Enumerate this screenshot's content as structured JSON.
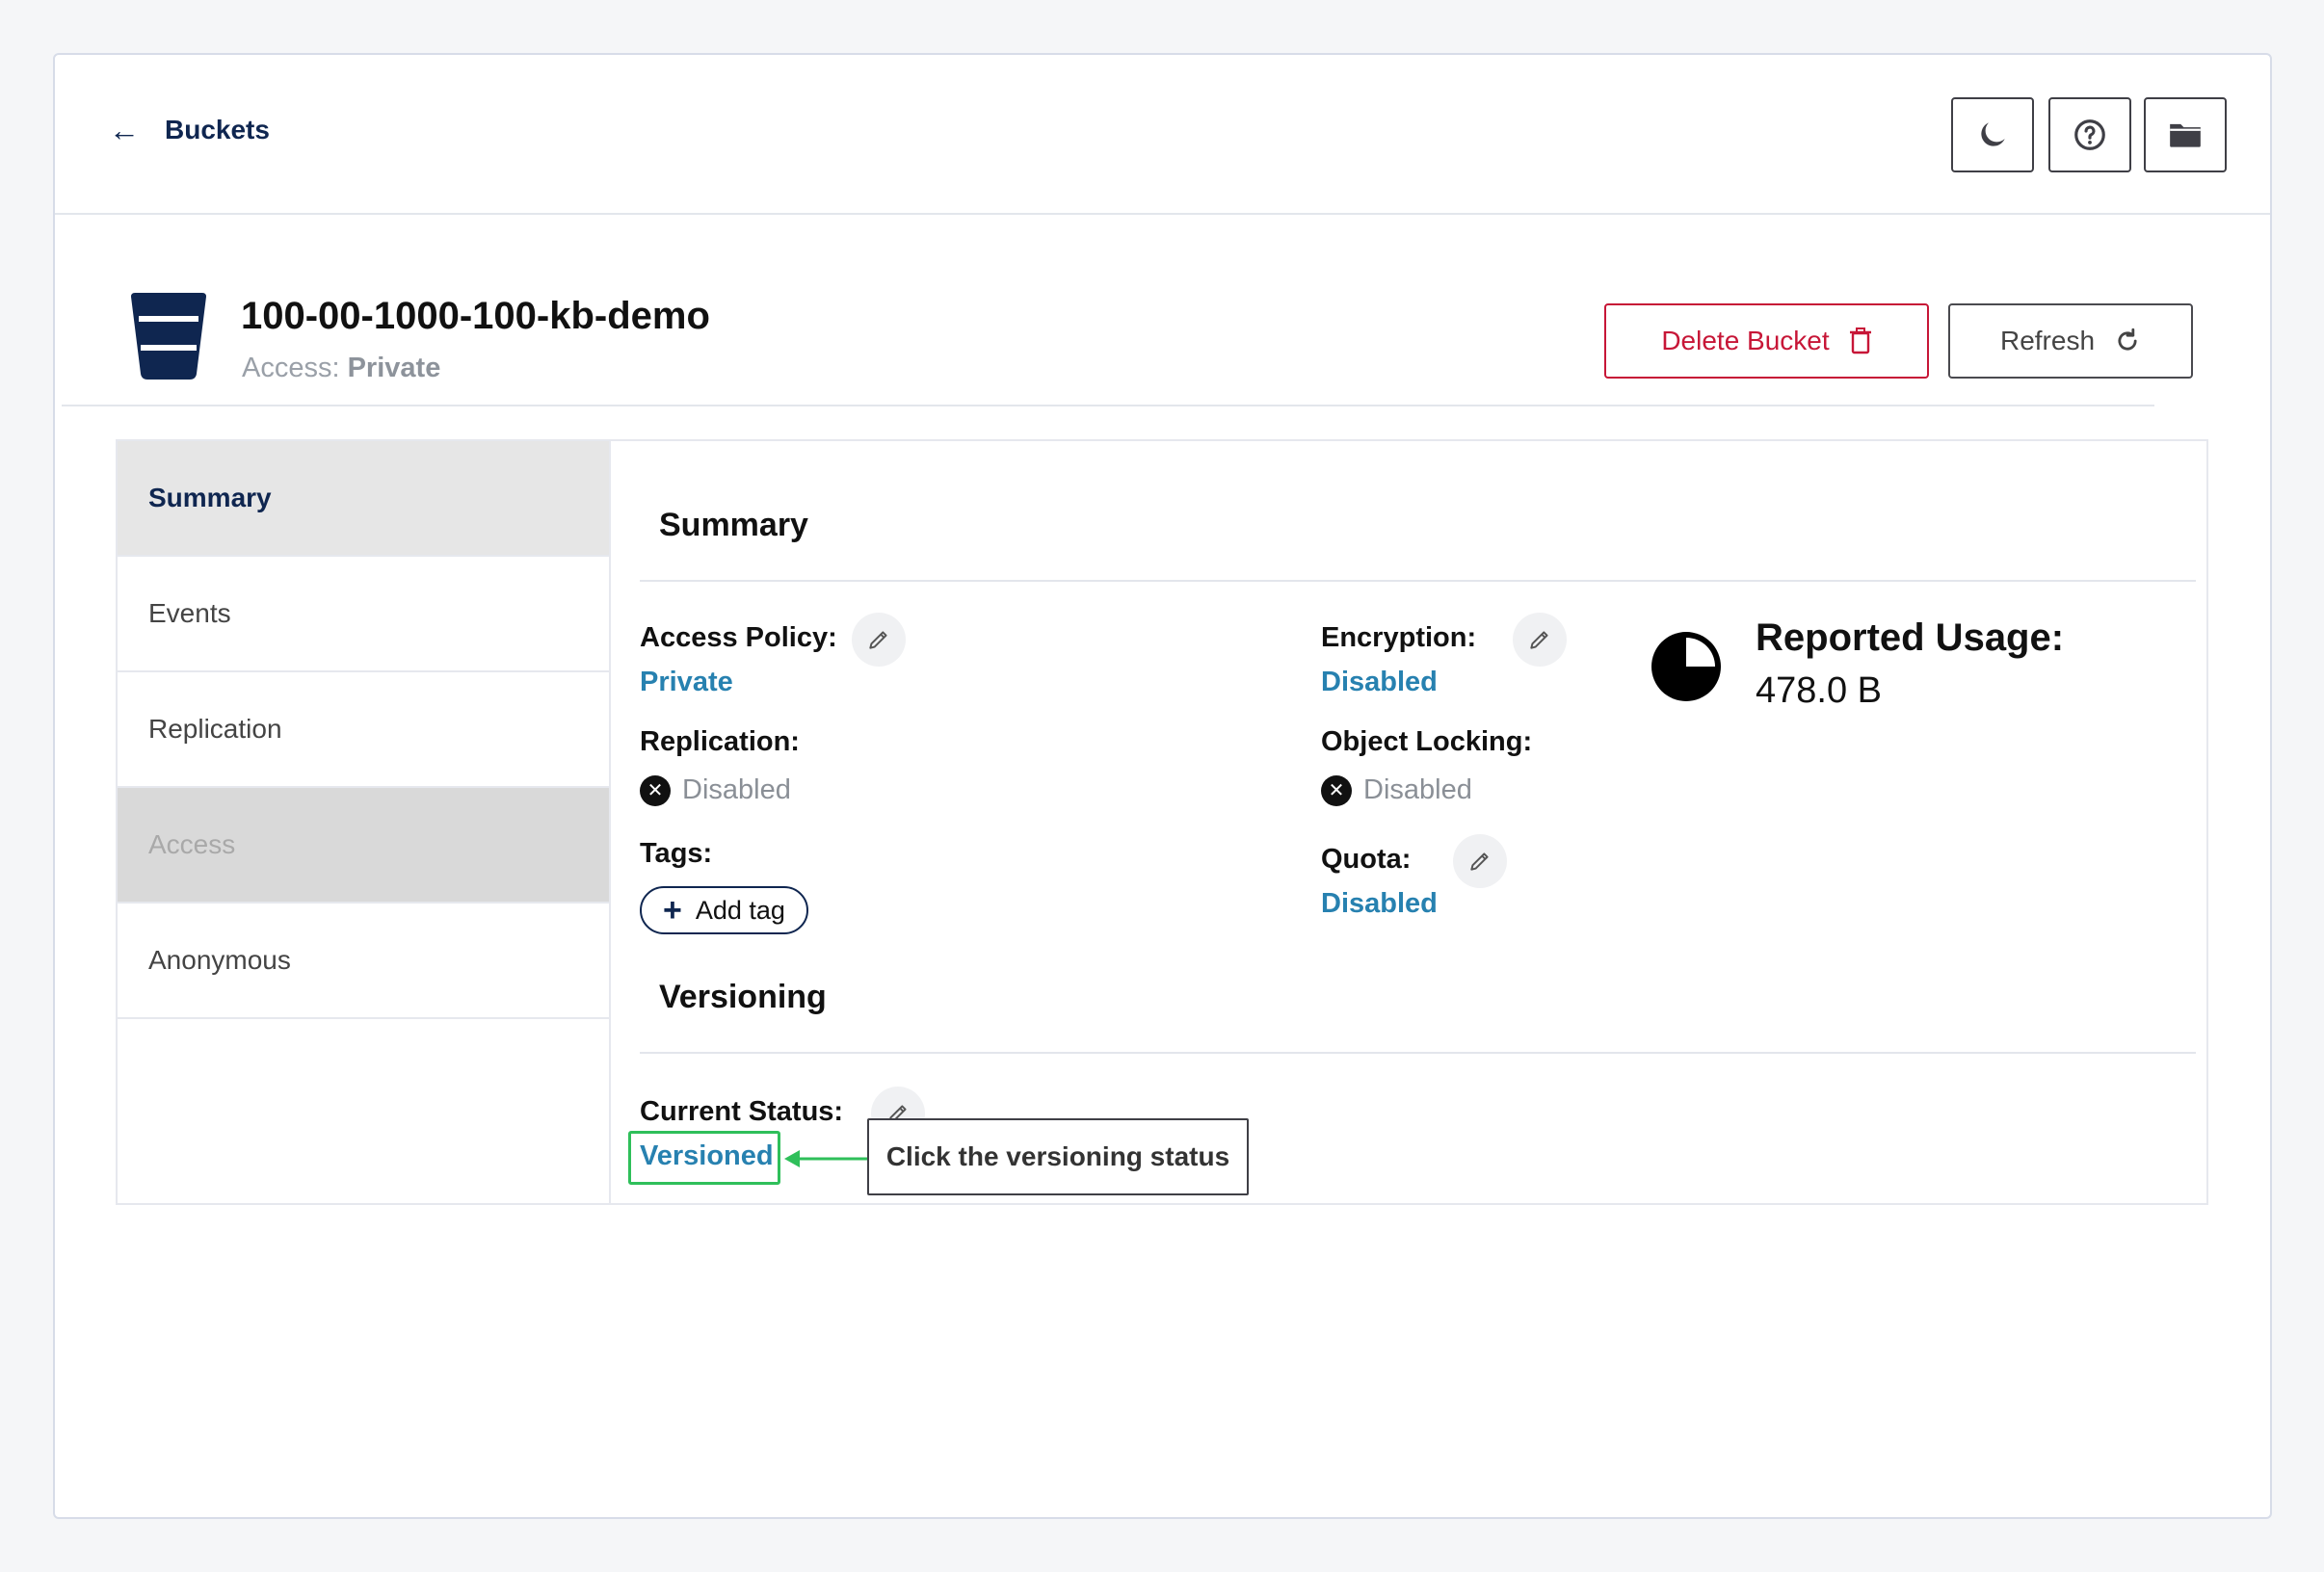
{
  "topbar": {
    "back_label": "Buckets",
    "buttons": [
      {
        "icon": "folder-icon"
      },
      {
        "icon": "help-icon"
      },
      {
        "icon": "moon-icon"
      }
    ]
  },
  "header": {
    "bucket_name": "100-00-1000-100-kb-demo",
    "access_prefix": "Access:",
    "access_value": "Private",
    "delete_label": "Delete Bucket",
    "refresh_label": "Refresh"
  },
  "sidenav": {
    "items": [
      {
        "label": "Summary",
        "state": "active"
      },
      {
        "label": "Events",
        "state": "normal"
      },
      {
        "label": "Replication",
        "state": "normal"
      },
      {
        "label": "Access",
        "state": "disabled"
      },
      {
        "label": "Anonymous",
        "state": "normal"
      }
    ]
  },
  "summary": {
    "title": "Summary",
    "access_policy_label": "Access Policy:",
    "access_policy_value": "Private",
    "replication_label": "Replication:",
    "replication_value": "Disabled",
    "tags_label": "Tags:",
    "add_tag_label": "Add tag",
    "encryption_label": "Encryption:",
    "encryption_value": "Disabled",
    "object_locking_label": "Object Locking:",
    "object_locking_value": "Disabled",
    "quota_label": "Quota:",
    "quota_value": "Disabled",
    "usage_label": "Reported Usage:",
    "usage_value": "478.0 B"
  },
  "versioning": {
    "title": "Versioning",
    "current_status_label": "Current Status:",
    "current_status_value": "Versioned"
  },
  "annotation": {
    "tooltip_text": "Click the versioning status",
    "highlight_color": "#2fbf5a"
  },
  "colors": {
    "navy": "#0f2650",
    "link": "#2781b0",
    "danger": "#c71637"
  }
}
